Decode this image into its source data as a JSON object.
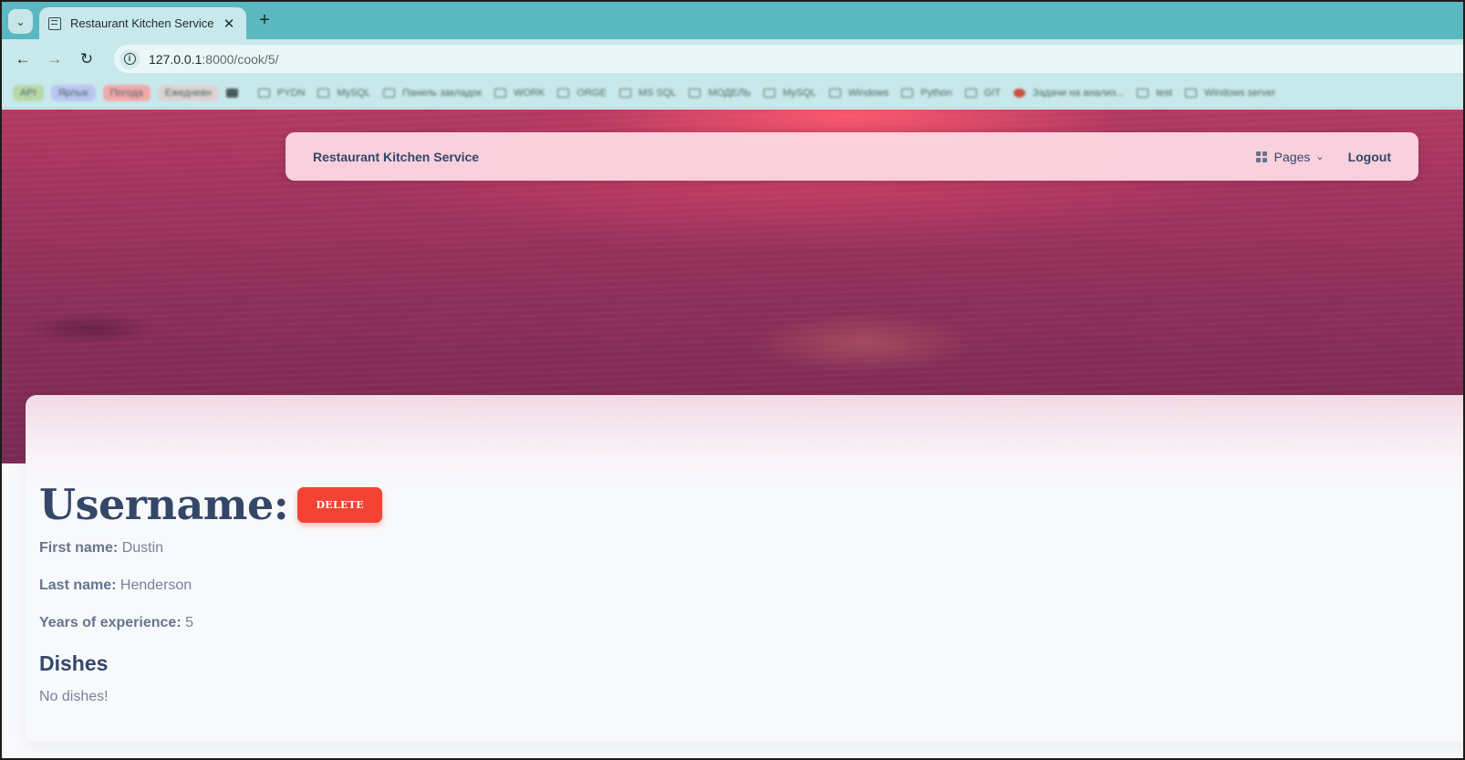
{
  "browser": {
    "tab_title": "Restaurant Kitchen Service",
    "url_host": "127.0.0.1",
    "url_path": ":8000/cook/5/",
    "bookmarks": [
      "API",
      "Ярлык",
      "Погода",
      "Ежедневн",
      "PYDN",
      "MySQL",
      "Панель закладок",
      "WORK",
      "ORGE",
      "MS SQL",
      "MОДЕЛЬ",
      "MySQL",
      "Windows",
      "Python",
      "GIT",
      "Задачи на анализ...",
      "test",
      "Windows server"
    ]
  },
  "navbar": {
    "brand": "Restaurant Kitchen Service",
    "pages_label": "Pages",
    "logout_label": "Logout"
  },
  "cook": {
    "heading": "Username:",
    "delete_label": "DELETE",
    "first_name_label": "First name:",
    "first_name": "Dustin",
    "last_name_label": "Last name:",
    "last_name": "Henderson",
    "experience_label": "Years of experience:",
    "experience": "5",
    "dishes_title": "Dishes",
    "dishes_empty": "No dishes!"
  },
  "colors": {
    "primary_text": "#344767",
    "danger": "#f44335",
    "chrome": "#5bb8c0"
  }
}
